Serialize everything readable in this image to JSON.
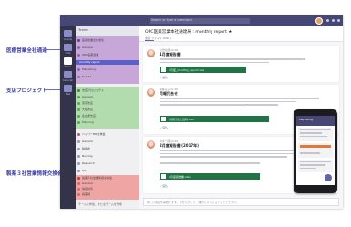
{
  "callouts": {
    "sales": "医療営業全社通達",
    "support": "支店プロジェクト",
    "info": "製薬３社営業情報交換会"
  },
  "window": {
    "search_placeholder": "Search or type a command",
    "teams_header": "Teams",
    "teams_footer": "チームに参加、またはチームを作成",
    "app_labels": [
      "Activity",
      "Chat",
      "Teams",
      "Calendar",
      "Files"
    ]
  },
  "teams": {
    "purple_rows": [
      "医療営業全社通達",
      "General",
      "OPC医薬営業",
      "monthly report",
      "Marketing",
      "Events"
    ],
    "green_rows": [
      "支店プロジェクト",
      "General",
      "東京支店",
      "大阪支店",
      "名古屋支店",
      "Planning"
    ],
    "middle_rows": [
      "ハイパーMR全体会",
      "General",
      "勉強会",
      "Nursing",
      "Research",
      "QA"
    ],
    "pink_rows": [
      "製薬３社営業情報交換会",
      "General",
      "情報共有",
      "議事録",
      "Schedule",
      "Archive"
    ]
  },
  "chat": {
    "title": "OPC医薬営業本社通達局 : monthly report ★",
    "tabs": "会話   ファイル   Wiki   +",
    "posts": [
      {
        "meta": "山田太郎 10:30",
        "title": "1月度報告書",
        "attachment": "1月度_monthly_report.xlsx",
        "reply": "↩ 返信"
      },
      {
        "meta": "佐藤花子 11:05",
        "title": "月報打合せ",
        "attachment": "月報打合せ資料.xlsx",
        "reply": "↩ 返信"
      },
      {
        "meta": "鈴木一郎 14:20",
        "title": "2月度報告書 (2017年)",
        "attachment": "2月度報告書.xlsx",
        "reply": "↩ 返信"
      }
    ],
    "composer_placeholder": "新しい会話を開始します。@を入力して、誰かにメンションしてください。"
  },
  "phone": {
    "header": "Marketing"
  }
}
